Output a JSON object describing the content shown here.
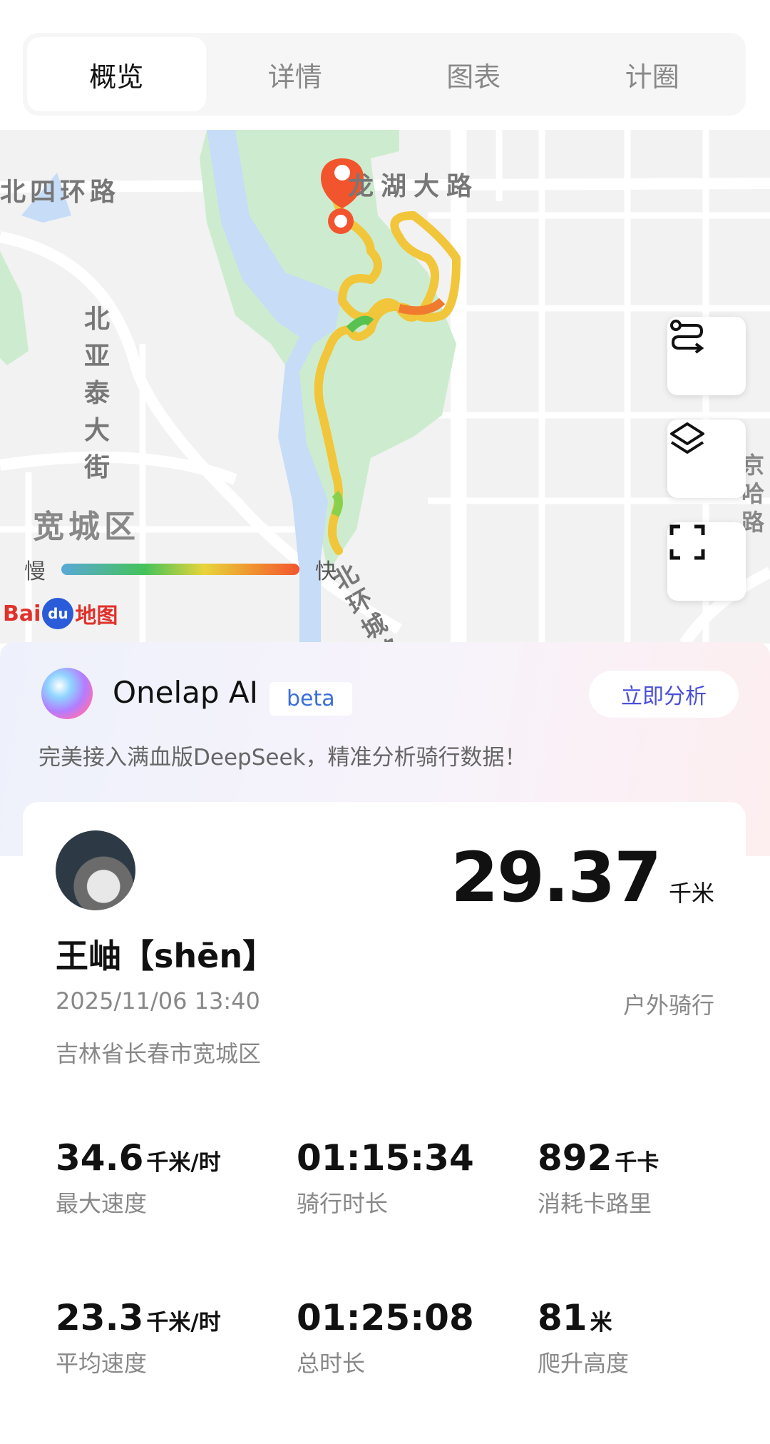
{
  "tabs": [
    {
      "label": "概览",
      "active": true
    },
    {
      "label": "详情",
      "active": false
    },
    {
      "label": "图表",
      "active": false
    },
    {
      "label": "计圈",
      "active": false
    }
  ],
  "map": {
    "roads": [
      "北四环路",
      "龙湖大路",
      "北亚泰大街",
      "北环城路",
      "宽城区",
      "京哈路"
    ],
    "legend": {
      "slow": "慢",
      "fast": "快"
    },
    "provider": {
      "bai": "Bai",
      "du": "du",
      "suffix": "地图"
    },
    "buttons": [
      "route-icon",
      "layers-icon",
      "fullscreen-icon"
    ]
  },
  "ai": {
    "title": "Onelap AI",
    "badge": "beta",
    "button": "立即分析",
    "description": "完美接入满血版DeepSeek，精准分析骑行数据！"
  },
  "ride": {
    "distance": "29.37",
    "distance_unit": "千米",
    "name": "王岫【shēn】",
    "datetime": "2025/11/06 13:40",
    "type": "户外骑行",
    "location": "吉林省长春市宽城区",
    "stats": [
      {
        "value": "34.6",
        "unit": "千米/时",
        "label": "最大速度"
      },
      {
        "value": "01:15:34",
        "unit": "",
        "label": "骑行时长"
      },
      {
        "value": "892",
        "unit": "千卡",
        "label": "消耗卡路里"
      },
      {
        "value": "23.3",
        "unit": "千米/时",
        "label": "平均速度"
      },
      {
        "value": "01:25:08",
        "unit": "",
        "label": "总时长"
      },
      {
        "value": "81",
        "unit": "米",
        "label": "爬升高度"
      }
    ]
  },
  "colors": {
    "accent": "#4a4fd8",
    "route_start": "#f2542d",
    "park": "#cdeccf",
    "water": "#c6dcf7"
  }
}
